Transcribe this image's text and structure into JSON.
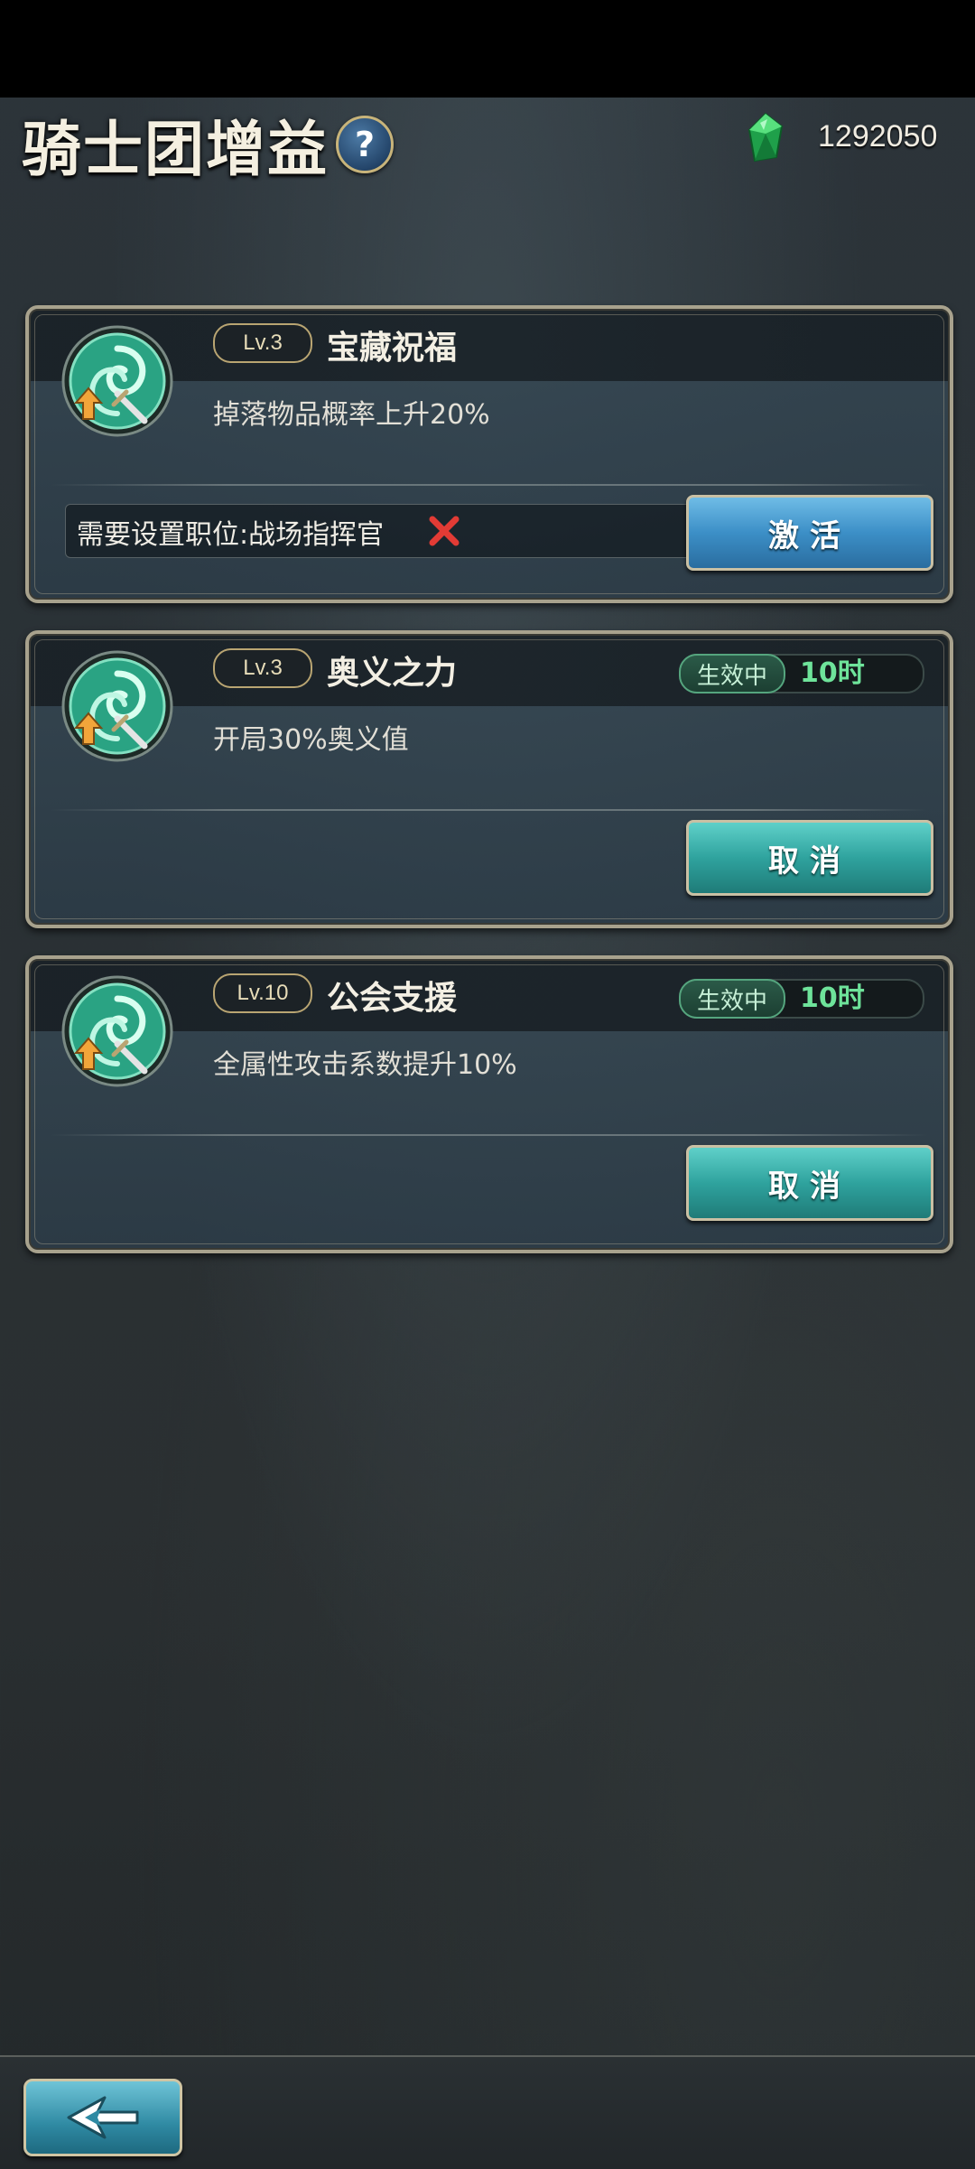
{
  "header": {
    "title": "骑士团增益",
    "help_symbol": "?",
    "currency_icon": "green-gem-icon",
    "currency_amount": "1292050"
  },
  "colors": {
    "active_green": "#6ee39a",
    "activate_button": "#3c8fc7",
    "cancel_button": "#2fa39e",
    "gold_border": "#b9a572"
  },
  "buffs": [
    {
      "level": "Lv.3",
      "name": "宝藏祝福",
      "description": "掉落物品概率上升20%",
      "requirement": "需要设置职位:战场指挥官",
      "requirement_met_icon": "red-x-icon",
      "button_label": "激活",
      "icon": "green-swirl-sword-icon"
    },
    {
      "level": "Lv.3",
      "name": "奥义之力",
      "description": "开局30%奥义值",
      "status": "生效中",
      "remaining": "10时",
      "button_label": "取消",
      "icon": "green-swirl-sword-icon"
    },
    {
      "level": "Lv.10",
      "name": "公会支援",
      "description": "全属性攻击系数提升10%",
      "status": "生效中",
      "remaining": "10时",
      "button_label": "取消",
      "icon": "green-swirl-sword-icon"
    }
  ],
  "footer": {
    "back_icon": "back-arrow-icon"
  }
}
